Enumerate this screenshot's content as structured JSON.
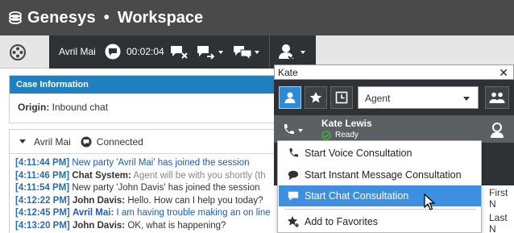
{
  "app": {
    "brand": "Genesys",
    "separator": "•",
    "name": "Workspace"
  },
  "toolbar": {
    "party_name": "Avril Mai",
    "timer": "00:02:04",
    "icons": [
      "genesys-menu-icon",
      "chat-icon",
      "end-chat-icon",
      "transfer-icon",
      "consult-icon",
      "agent-status-icon"
    ]
  },
  "case": {
    "header": "Case Information",
    "origin_label": "Origin:",
    "origin_value": "Inbound chat"
  },
  "chat": {
    "party": "Avril Mai",
    "status": "Connected",
    "lines": [
      {
        "ts": "[4:11:44 PM]",
        "text": "New party 'Avril Mai' has joined the session",
        "style": "blue"
      },
      {
        "ts": "[4:11:46 PM]",
        "who": "Chat System:",
        "text": "Agent will be with you shortly (th",
        "style": "gray"
      },
      {
        "ts": "[4:11:54 PM]",
        "text": "New party 'John Davis' has joined the session",
        "style": "dark"
      },
      {
        "ts": "[4:12:22 PM]",
        "who": "John Davis:",
        "text": "Hello. How can I help you today?",
        "style": "dark"
      },
      {
        "ts": "[4:12:45 PM]",
        "who": "Avril Mai:",
        "text": "I am having trouble making an on line",
        "style": "blue"
      },
      {
        "ts": "[4:13:20 PM]",
        "who": "John Davis:",
        "text": "OK, what is happening?",
        "style": "dark"
      }
    ]
  },
  "right_labels": {
    "first": "First N",
    "last": "Last N"
  },
  "team_communicator": {
    "query": "Kate",
    "filter_type": "Agent",
    "result": {
      "name": "Kate Lewis",
      "status": "Ready"
    }
  },
  "menu": {
    "items": [
      {
        "label": "Start Voice Consultation",
        "icon": "phone-icon"
      },
      {
        "label": "Start Instant Message Consultation",
        "icon": "im-bubble-icon"
      },
      {
        "label": "Start Chat Consultation",
        "icon": "chat-bubble-icon",
        "selected": true
      },
      {
        "label": "Add to Favorites",
        "icon": "star-plus-icon"
      }
    ]
  },
  "colors": {
    "accent": "#3f8fe0",
    "header_blue": "#1f7fbf",
    "dark": "#2e3235",
    "ready": "#3cb043"
  }
}
